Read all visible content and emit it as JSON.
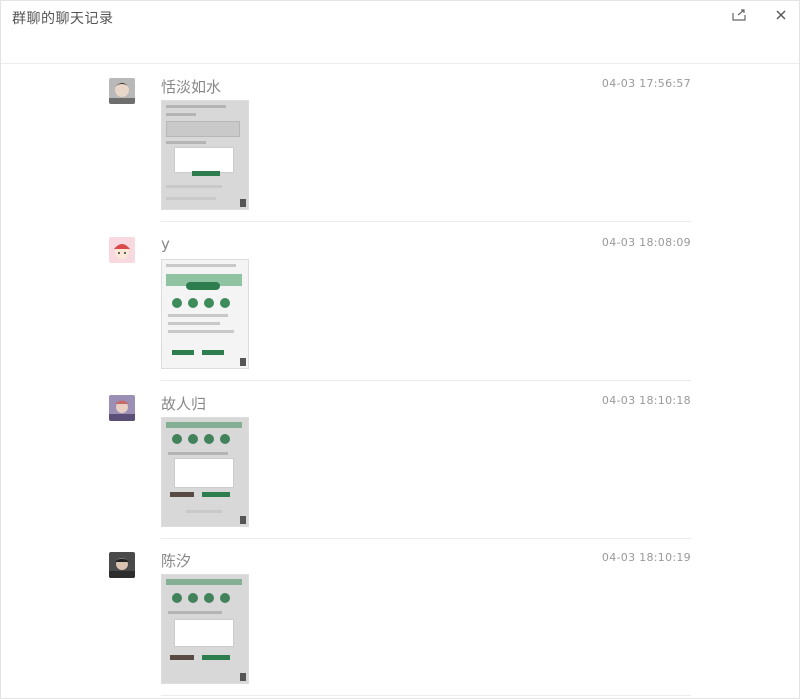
{
  "window": {
    "title": "群聊的聊天记录"
  },
  "messages": [
    {
      "sender": "恬淡如水",
      "time": "04-03 17:56:57"
    },
    {
      "sender": "y",
      "time": "04-03 18:08:09"
    },
    {
      "sender": "故人归",
      "time": "04-03 18:10:18"
    },
    {
      "sender": "陈汐",
      "time": "04-03 18:10:19"
    }
  ],
  "icons": {
    "share": "share-icon",
    "close": "close-icon"
  },
  "colors": {
    "accent_green": "#2e7d4f",
    "text_name": "#888888",
    "text_time": "#999999"
  }
}
